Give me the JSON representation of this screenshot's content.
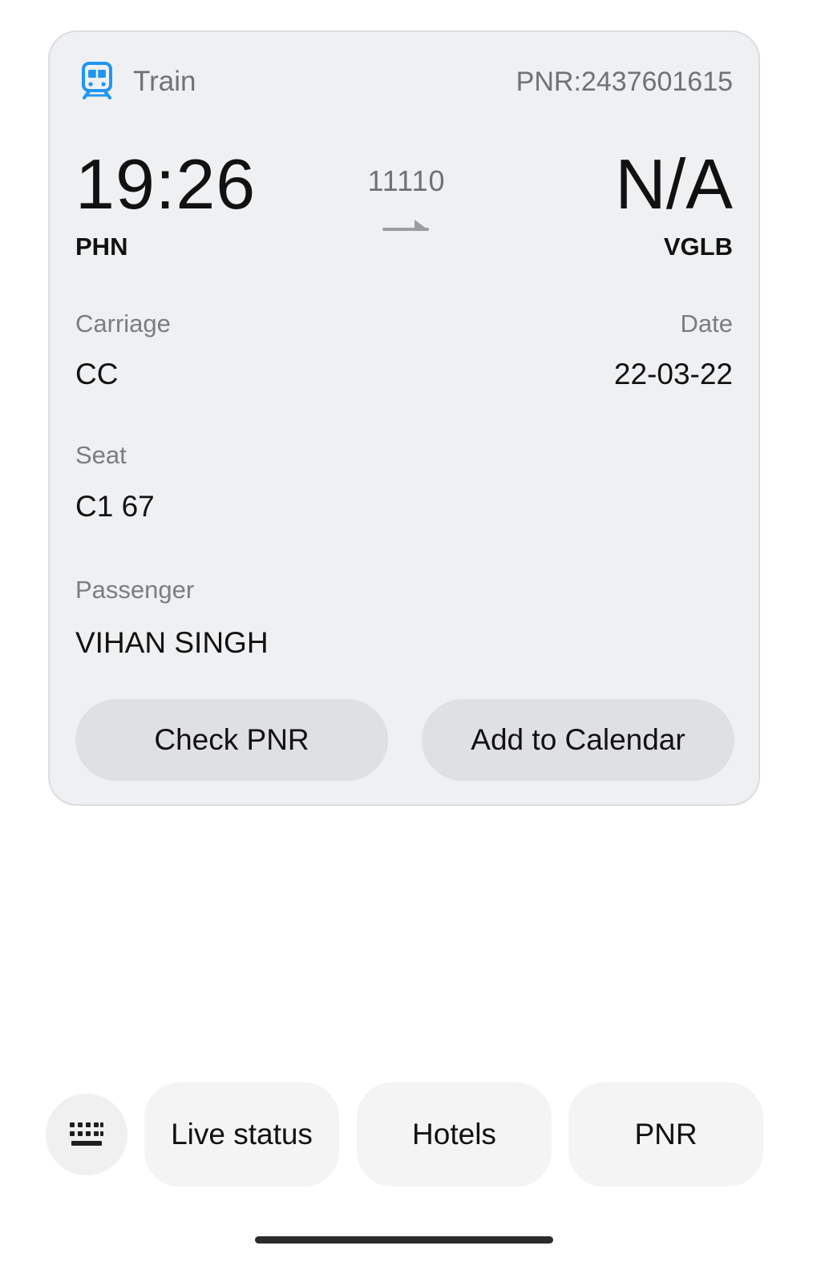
{
  "ticket": {
    "type_label": "Train",
    "type_icon": "train-icon",
    "pnr_label": "PNR:2437601615",
    "departure_time": "19:26",
    "arrival_time": "N/A",
    "from_station": "PHN",
    "to_station": "VGLB",
    "train_number": "11110",
    "route_icon": "arrow-right-icon",
    "carriage_label": "Carriage",
    "carriage_value": "CC",
    "date_label": "Date",
    "date_value": "22-03-22",
    "seat_label": "Seat",
    "seat_value": "C1 67",
    "passenger_label": "Passenger",
    "passenger_value": "VIHAN SINGH",
    "accent_color": "#2196f3"
  },
  "actions": {
    "check_pnr": "Check PNR",
    "add_to_calendar": "Add to Calendar"
  },
  "quick_replies": {
    "keyboard_icon": "keyboard-icon",
    "chips": [
      "Live status",
      "Hotels",
      "PNR"
    ]
  }
}
